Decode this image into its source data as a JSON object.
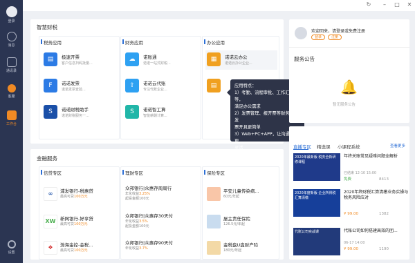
{
  "sidebar": {
    "items": [
      {
        "label": "登录"
      },
      {
        "label": "消息"
      },
      {
        "label": "通讯录"
      },
      {
        "label": "客服"
      },
      {
        "label": "工作台"
      },
      {
        "label": "设置"
      }
    ]
  },
  "window": {
    "refresh": "↻",
    "min": "–",
    "max": "□",
    "close": "✕"
  },
  "smart_tax": {
    "title": "智慧财税",
    "cols": [
      {
        "title": "税务应用",
        "apps": [
          {
            "name": "极速开票",
            "desc": "客户信息扫码批量..."
          },
          {
            "name": "诺诺发票",
            "desc": "诺诺发票查验..."
          },
          {
            "name": "诺诺财税助手",
            "desc": "诺诺财税服务一..."
          }
        ]
      },
      {
        "title": "财务应用",
        "apps": [
          {
            "name": "诺账通",
            "desc": "诺诺一站式财税..."
          },
          {
            "name": "诺诺云代账",
            "desc": "专注代账企业..."
          },
          {
            "name": "诺诺智工算",
            "desc": "智能薪酬计算..."
          }
        ]
      },
      {
        "title": "办公应用",
        "apps": [
          {
            "name": "诺诺云办公",
            "desc": "诺诺云办公企业..."
          },
          {
            "name": "",
            "desc": ""
          }
        ]
      }
    ]
  },
  "tooltip": {
    "lines": [
      "应用特点：",
      "1）考勤、流程审批、工作汇报等，",
      "满足办公需求",
      "2）发票管理、报开票等财务功能发",
      "票开具更简单",
      "3）Web+PC+APP，让沟通协作更",
      "灵活"
    ]
  },
  "user": {
    "welcome": "欢迎回来，请登录或免费注册",
    "login": "登录",
    "register": "注册"
  },
  "announce": {
    "title": "服务公告",
    "empty": "暂无服务公告"
  },
  "finance": {
    "title": "金融服务",
    "cols": [
      {
        "title": "信贷专区",
        "items": [
          {
            "name": "浦发银行-税惠贷",
            "l2": "最高可贷",
            "hi": "100万元",
            "l3": ""
          },
          {
            "name": "新网银行-好享贷",
            "l2": "最高可贷",
            "hi": "100万元",
            "l3": ""
          },
          {
            "name": "渤海金控-金税...",
            "l2": "最高可贷",
            "hi": "100万元",
            "l3": ""
          }
        ]
      },
      {
        "title": "理财专区",
        "items": [
          {
            "name": "众邦银行|众惠存周周行",
            "l2": "年化收益",
            "hi": "3.25%",
            "l3": "起投金额100元"
          },
          {
            "name": "众邦银行|众惠存30天付",
            "l2": "年化收益",
            "hi": "3.5%",
            "l3": "起投金额100元"
          },
          {
            "name": "众邦银行|众惠存90天付",
            "l2": "年化收益",
            "hi": "3.7%",
            "l3": ""
          }
        ]
      },
      {
        "title": "保险专区",
        "items": [
          {
            "name": "平安儿童传染病...",
            "l2": "",
            "hi": "60元/年起",
            "l3": ""
          },
          {
            "name": "屋主责任保险",
            "l2": "",
            "hi": "126.5元/年起",
            "l3": ""
          },
          {
            "name": "金税盘U盘财产险",
            "l2": "",
            "hi": "180元/年起",
            "l3": ""
          }
        ]
      }
    ]
  },
  "news": {
    "tabs": [
      "直播专区",
      "精选课",
      "小课程系统"
    ],
    "more": "查看更多",
    "items": [
      {
        "thumb": "2020年最新版 税务全新研修课程",
        "title": "年终关账常见疑难问题全解析",
        "meta": "已结束 12-10 15:00",
        "price": "免费",
        "views": "8413"
      },
      {
        "thumb": "2020年度新版 企业所得税汇算清缴",
        "title": "2020年终财税汇算清缴业务实操与税务风险应对",
        "meta": "",
        "price": "¥ 99.00",
        "views": "1382"
      },
      {
        "thumb": "代账公司实战课",
        "title": "代账公司如何搭建高效的团...",
        "meta": "06-17 14:00",
        "price": "¥ 99.00",
        "views": "1190"
      }
    ]
  },
  "colors": {
    "sidebar": "#2b3552",
    "accent": "#2c6fd6",
    "orange": "#f08a24"
  }
}
